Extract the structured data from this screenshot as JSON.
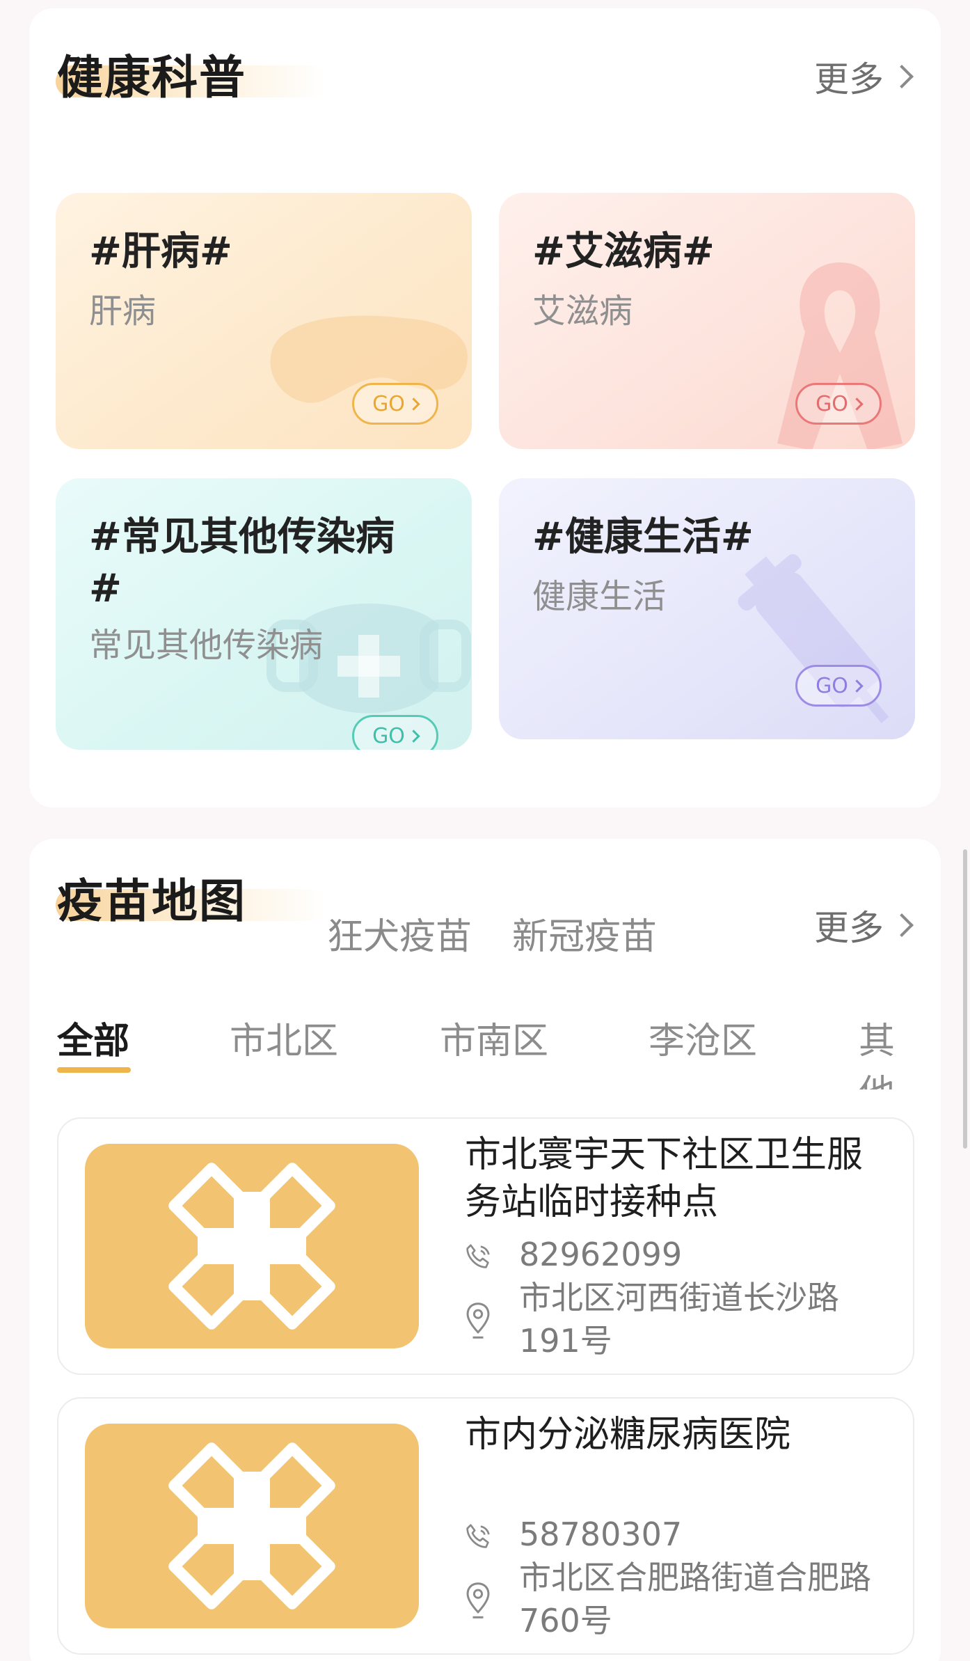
{
  "health": {
    "title": "健康科普",
    "more": "更多",
    "cards": [
      {
        "tag": "#肝病#",
        "sub": "肝病",
        "go": "GO",
        "accent": "#f0b54a"
      },
      {
        "tag": "#艾滋病#",
        "sub": "艾滋病",
        "go": "GO",
        "accent": "#ea7878"
      },
      {
        "tag_line1": "#常见其他传染病",
        "tag_line2": "#",
        "sub": "常见其他传染病",
        "go": "GO",
        "accent": "#55cbb6"
      },
      {
        "tag": "#健康生活#",
        "sub": "健康生活",
        "go": "GO",
        "accent": "#9d8ce6"
      }
    ]
  },
  "vaccine": {
    "title": "疫苗地图",
    "tabs": [
      "狂犬疫苗",
      "新冠疫苗"
    ],
    "more": "更多",
    "districts": [
      "全部",
      "市北区",
      "市南区",
      "李沧区",
      "其他"
    ],
    "active_district": "全部",
    "sites": [
      {
        "name": "市北寰宇天下社区卫生服务站临时接种点",
        "phone": "82962099",
        "address": "市北区河西街道长沙路191号"
      },
      {
        "name": "市内分泌糖尿病医院",
        "phone": "58780307",
        "address": "市北区合肥路街道合肥路760号"
      }
    ]
  },
  "colors": {
    "brand_orange": "#f2c472",
    "active_tab_underline": "#f0b54a"
  }
}
